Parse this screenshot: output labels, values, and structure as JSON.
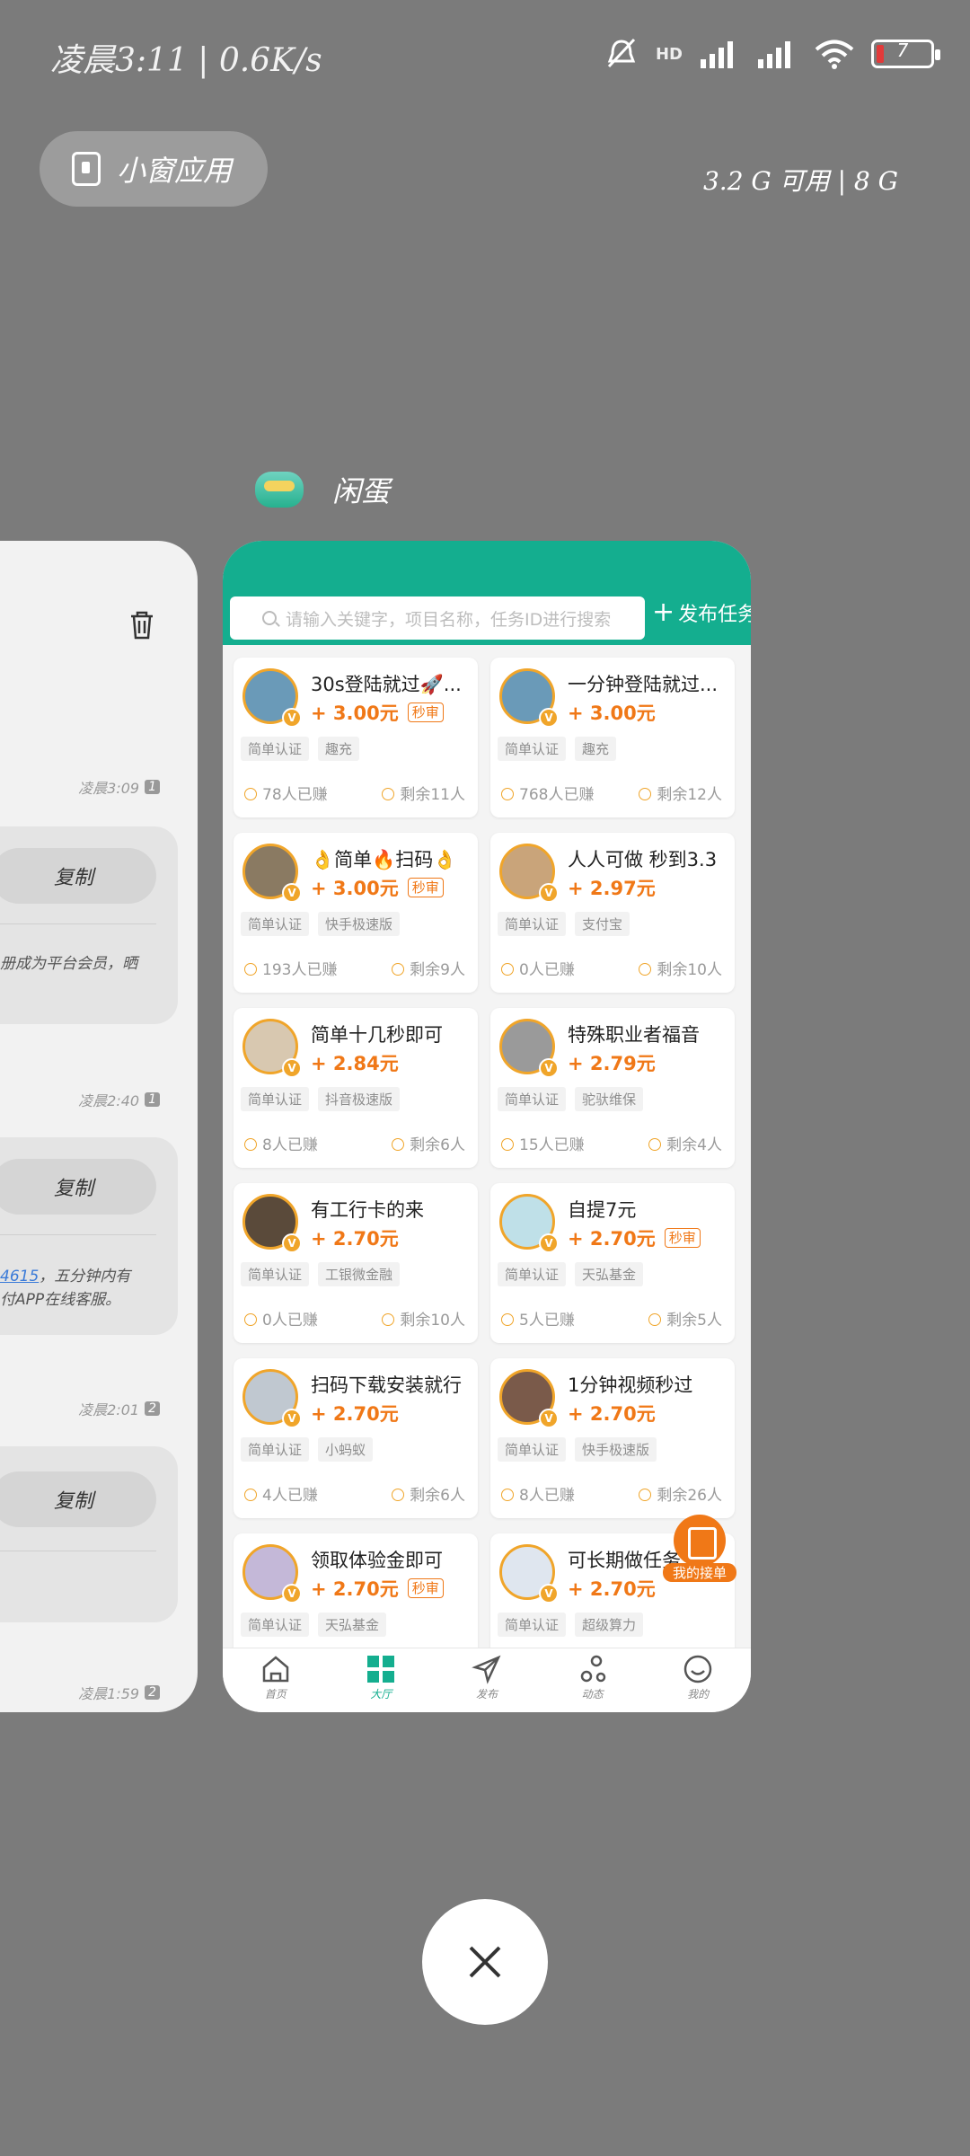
{
  "status_bar": {
    "time": "凌晨3:11 | 0.6K/s",
    "battery_level": "7",
    "network": "HD"
  },
  "recents": {
    "small_window_label": "小窗应用",
    "memory": "3.2 G 可用 | 8 G"
  },
  "left_card": {
    "entries": [
      {
        "time": "凌晨3:09",
        "count": "1"
      },
      {
        "copy_label": "复制",
        "text": "册成为平台会员，晒"
      },
      {
        "time": "凌晨2:40",
        "count": "1"
      },
      {
        "copy_label": "复制",
        "text_link": "4615",
        "text_after": "，五分钟内有",
        "text_line2": "付APP在线客服。"
      },
      {
        "time": "凌晨2:01",
        "count": "2"
      },
      {
        "copy_label": "复制"
      },
      {
        "time": "凌晨1:59",
        "count": "2"
      }
    ]
  },
  "app": {
    "name": "闲蛋",
    "search_placeholder": "请输入关键字，项目名称，任务ID进行搜索",
    "publish_label": "发布任务",
    "tasks": [
      {
        "title": "30s登陆就过🚀...",
        "price": "+ 3.00元",
        "fast_review": "秒审",
        "tags": [
          "简单认证",
          "趣充"
        ],
        "earned": "78人已赚",
        "remaining": "剩余11人",
        "avatar_color": "#6a9ab8"
      },
      {
        "title": "一分钟登陆就过...",
        "price": "+ 3.00元",
        "fast_review": "",
        "tags": [
          "简单认证",
          "趣充"
        ],
        "earned": "768人已赚",
        "remaining": "剩余12人",
        "avatar_color": "#6a9ab8"
      },
      {
        "title": "👌简单🔥扫码👌",
        "price": "+ 3.00元",
        "fast_review": "秒审",
        "tags": [
          "简单认证",
          "快手极速版"
        ],
        "earned": "193人已赚",
        "remaining": "剩余9人",
        "avatar_color": "#8a7a62"
      },
      {
        "title": "人人可做 秒到3.3",
        "price": "+ 2.97元",
        "fast_review": "",
        "tags": [
          "简单认证",
          "支付宝"
        ],
        "earned": "0人已赚",
        "remaining": "剩余10人",
        "avatar_color": "#c9a47a"
      },
      {
        "title": "简单十几秒即可",
        "price": "+ 2.84元",
        "fast_review": "",
        "tags": [
          "简单认证",
          "抖音极速版"
        ],
        "earned": "8人已赚",
        "remaining": "剩余6人",
        "avatar_color": "#d8c8b0"
      },
      {
        "title": "特殊职业者福音",
        "price": "+ 2.79元",
        "fast_review": "",
        "tags": [
          "简单认证",
          "驼驮维保"
        ],
        "earned": "15人已赚",
        "remaining": "剩余4人",
        "avatar_color": "#9a9a9a"
      },
      {
        "title": "有工行卡的来",
        "price": "+ 2.70元",
        "fast_review": "",
        "tags": [
          "简单认证",
          "工银微金融"
        ],
        "earned": "0人已赚",
        "remaining": "剩余10人",
        "avatar_color": "#5a4a3a"
      },
      {
        "title": "自提7元",
        "price": "+ 2.70元",
        "fast_review": "秒审",
        "tags": [
          "简单认证",
          "天弘基金"
        ],
        "earned": "5人已赚",
        "remaining": "剩余5人",
        "avatar_color": "#bfe0e8"
      },
      {
        "title": "扫码下载安装就行",
        "price": "+ 2.70元",
        "fast_review": "",
        "tags": [
          "简单认证",
          "小蚂蚁"
        ],
        "earned": "4人已赚",
        "remaining": "剩余6人",
        "avatar_color": "#c0c8d0"
      },
      {
        "title": "1分钟视频秒过",
        "price": "+ 2.70元",
        "fast_review": "",
        "tags": [
          "简单认证",
          "快手极速版"
        ],
        "earned": "8人已赚",
        "remaining": "剩余26人",
        "avatar_color": "#7a5a4a"
      },
      {
        "title": "领取体验金即可",
        "price": "+ 2.70元",
        "fast_review": "秒审",
        "tags": [
          "简单认证",
          "天弘基金"
        ],
        "earned": "",
        "remaining": "",
        "avatar_color": "#c4b8d8"
      },
      {
        "title": "可长期做任务",
        "price": "+ 2.70元",
        "fast_review": "",
        "tags": [
          "简单认证",
          "超级算力"
        ],
        "earned": "",
        "remaining": "",
        "avatar_color": "#dfe6ef"
      }
    ],
    "fab_label": "我的接单",
    "tabs": [
      {
        "label": "首页",
        "icon": "home-icon"
      },
      {
        "label": "大厅",
        "icon": "grid-icon"
      },
      {
        "label": "发布",
        "icon": "send-icon"
      },
      {
        "label": "动态",
        "icon": "bubbles-icon"
      },
      {
        "label": "我的",
        "icon": "smile-icon"
      }
    ]
  },
  "colors": {
    "brand": "#14ae8f",
    "price": "#f07817",
    "avatar_ring": "#f0a52a",
    "overlay": "#7b7b7b"
  }
}
